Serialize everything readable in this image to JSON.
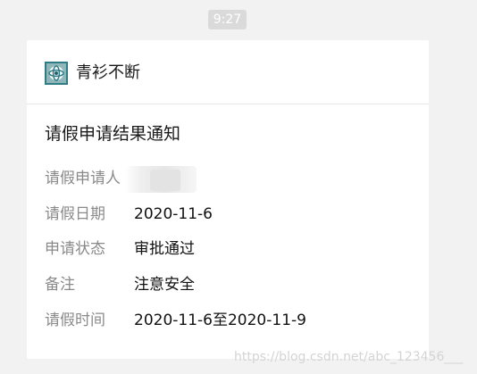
{
  "timestamp": "9:27",
  "account": {
    "name": "青衫不断",
    "avatar_icon": "globe-avatar-icon"
  },
  "notice": {
    "title": "请假申请结果通知",
    "fields": [
      {
        "label": "请假申请人",
        "value": ""
      },
      {
        "label": "请假日期",
        "value": "2020-11-6"
      },
      {
        "label": "申请状态",
        "value": "审批通过"
      },
      {
        "label": "备注",
        "value": "注意安全"
      },
      {
        "label": "请假时间",
        "value": "2020-11-6至2020-11-9"
      }
    ]
  },
  "watermark": "https://blog.csdn.net/abc_123456___",
  "colors": {
    "background": "#f2f2f2",
    "card": "#ffffff",
    "time_badge": "#dadada",
    "label": "#8a8a8a",
    "text": "#111111"
  }
}
